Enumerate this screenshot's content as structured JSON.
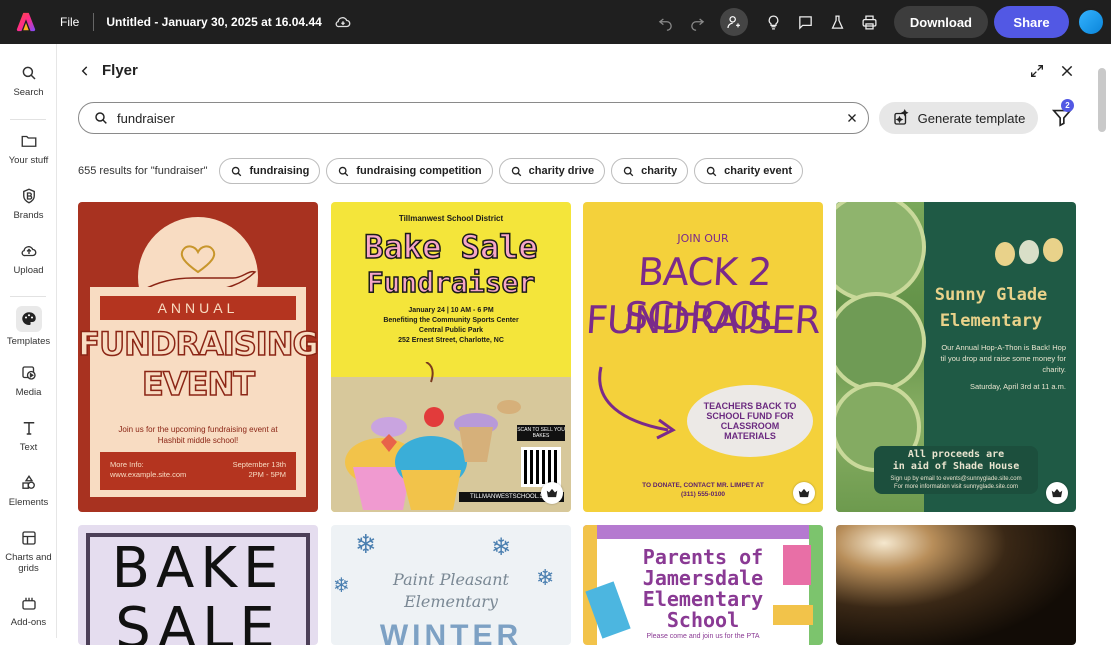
{
  "topbar": {
    "file_label": "File",
    "doc_title": "Untitled - January 30, 2025 at 16.04.44",
    "download_label": "Download",
    "share_label": "Share",
    "brand_color": "#1f1f1f",
    "share_color": "#5258e4"
  },
  "rail": {
    "items": [
      {
        "label": "Search",
        "icon": "search-icon"
      },
      {
        "label": "Your stuff",
        "icon": "folder-icon"
      },
      {
        "label": "Brands",
        "icon": "brand-icon"
      },
      {
        "label": "Upload",
        "icon": "upload-icon"
      },
      {
        "label": "Templates",
        "icon": "templates-icon"
      },
      {
        "label": "Media",
        "icon": "media-icon"
      },
      {
        "label": "Text",
        "icon": "text-icon"
      },
      {
        "label": "Elements",
        "icon": "elements-icon"
      },
      {
        "label": "Charts and grids",
        "icon": "charts-icon"
      },
      {
        "label": "Add-ons",
        "icon": "addons-icon"
      }
    ],
    "active": "Templates"
  },
  "panel": {
    "title": "Flyer",
    "search_value": "fundraiser",
    "generate_label": "Generate template",
    "filter_count": "2",
    "result_count": "655 results for \"fundraiser\"",
    "chips": [
      "fundraising",
      "fundraising competition",
      "charity drive",
      "charity",
      "charity event"
    ]
  },
  "templates": {
    "t1": {
      "annual": "ANNUAL",
      "line1": "FUNDRAISING",
      "line2": "EVENT",
      "body": "Join us for the upcoming fundraising event at Hashbit middle school!",
      "info_label": "More Info:",
      "info_site": "www.example.site.com",
      "date": "September 13th",
      "time": "2PM - 5PM"
    },
    "t2": {
      "district": "Tillmanwest School District",
      "line1": "Bake Sale",
      "line2": "Fundraiser",
      "date": "January 24 | 10 AM - 6 PM",
      "benefit": "Benefiting the Community Sports Center",
      "park": "Central Public Park",
      "address": "252 Ernest Street, Charlotte, NC",
      "scan": "SCAN TO SELL YOU BAKES",
      "site": "TILLMANWESTSCHOOL.SITE"
    },
    "t3": {
      "join": "JOIN OUR",
      "line1": "BACK 2 SCHOOL",
      "line2": "FUNDRAISER",
      "oval": "TEACHERS BACK TO SCHOOL FUND FOR CLASSROOM MATERIALS",
      "contact1": "TO DONATE, CONTACT MR. LIMPET AT",
      "contact2": "(311) 555-0100"
    },
    "t4": {
      "line1": "Sunny Glade",
      "line2": "Elementary",
      "text1": "Our Annual Hop-A-Thon is Back! Hop til you drop and raise some money for charity.",
      "text2": "Saturday, April 3rd at 11 a.m.",
      "proceeds1": "All proceeds are",
      "proceeds2": "in aid of Shade House",
      "small1": "Sign up by email to events@sunnyglade.site.com",
      "small2": "For more information visit sunnyglade.site.com"
    },
    "t5": {
      "line1": "BAKE",
      "line2": "SALE"
    },
    "t6": {
      "line1": "Paint Pleasant",
      "line2": "Elementary",
      "line3": "WINTER"
    },
    "t7": {
      "line1": "Parents of",
      "line2": "Jamersdale",
      "line3": "Elementary",
      "line4": "School",
      "small": "Please come and join us for the PTA"
    }
  }
}
